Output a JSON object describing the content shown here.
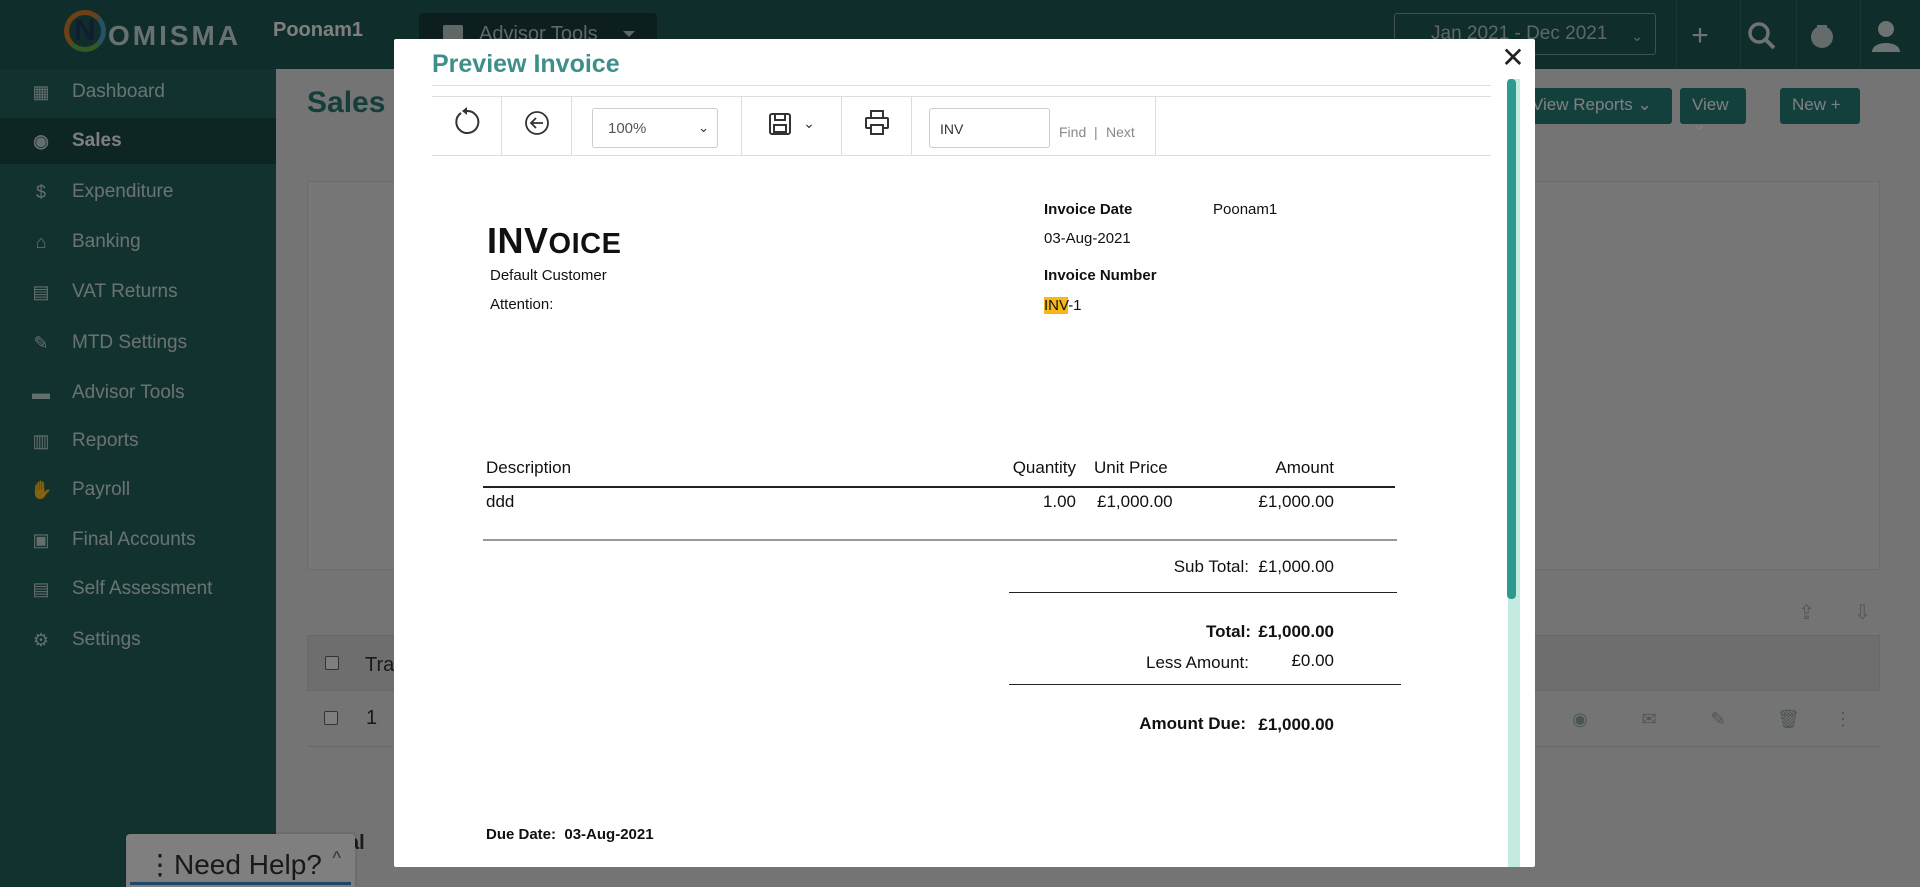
{
  "app": {
    "logo_text": "NOMISMA",
    "company": "Poonam1",
    "advisor_tools_label": "Advisor Tools",
    "period": "Jan 2021 - Dec 2021"
  },
  "sidebar": {
    "items": [
      {
        "label": "Dashboard",
        "icon": "dashboard-icon"
      },
      {
        "label": "Sales",
        "icon": "sales-icon",
        "active": true
      },
      {
        "label": "Expenditure",
        "icon": "money-bag-icon"
      },
      {
        "label": "Banking",
        "icon": "bank-icon"
      },
      {
        "label": "VAT Returns",
        "icon": "vat-icon"
      },
      {
        "label": "MTD Settings",
        "icon": "mtd-icon"
      },
      {
        "label": "Advisor Tools",
        "icon": "briefcase-icon"
      },
      {
        "label": "Reports",
        "icon": "reports-icon"
      },
      {
        "label": "Payroll",
        "icon": "payroll-icon"
      },
      {
        "label": "Final Accounts",
        "icon": "final-accounts-icon"
      },
      {
        "label": "Self Assessment",
        "icon": "self-assessment-icon"
      },
      {
        "label": "Settings",
        "icon": "gear-icon"
      }
    ]
  },
  "main": {
    "title": "Sales",
    "view_reports_label": "View Reports",
    "view_label": "View",
    "new_label": "New",
    "table_header_partial": "Tra",
    "row_number": "1",
    "footer_partial": "al"
  },
  "help": {
    "label": "Need Help?"
  },
  "modal": {
    "title": "Preview Invoice",
    "zoom": "100%",
    "find_value": "INV",
    "find_label": "Find",
    "find_sep": "|",
    "next_label": "Next"
  },
  "invoice": {
    "heading_big1": "INV",
    "heading_small": "OICE",
    "customer": "Default Customer",
    "attention_label": "Attention:",
    "invoice_date_label": "Invoice Date",
    "invoice_date": "03-Aug-2021",
    "company_name": "Poonam1",
    "invoice_number_label": "Invoice Number",
    "invoice_number_highlight": "INV",
    "invoice_number_rest": "-1",
    "columns": {
      "description": "Description",
      "quantity": "Quantity",
      "unit_price": "Unit Price",
      "amount": "Amount"
    },
    "lines": [
      {
        "description": "ddd",
        "quantity": "1.00",
        "unit_price": "£1,000.00",
        "amount": "£1,000.00"
      }
    ],
    "sub_total_label": "Sub Total:",
    "sub_total": "£1,000.00",
    "total_label": "Total:",
    "total": "£1,000.00",
    "less_amount_label": "Less Amount:",
    "less_amount": "£0.00",
    "amount_due_label": "Amount Due:",
    "amount_due": "£1,000.00",
    "due_date_label": "Due Date:",
    "due_date": "03-Aug-2021"
  },
  "colors": {
    "brand_teal": "#256561",
    "accent": "#3e8f8a",
    "highlight": "#f6b818"
  }
}
